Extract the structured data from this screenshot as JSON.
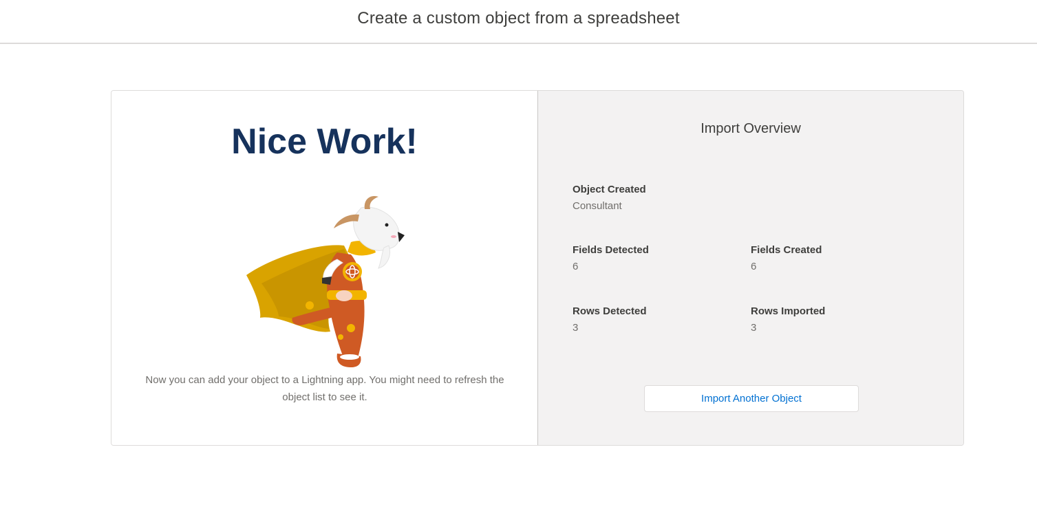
{
  "header": {
    "title": "Create a custom object from a spreadsheet"
  },
  "success": {
    "headline": "Nice Work!",
    "mascot_icon": "goat-superhero-mascot-icon",
    "message": "Now you can add your object to a Lightning app. You might need to refresh the object list to see it."
  },
  "overview": {
    "title": "Import Overview",
    "object_created": {
      "label": "Object Created",
      "value": "Consultant"
    },
    "fields_detected": {
      "label": "Fields Detected",
      "value": "6"
    },
    "fields_created": {
      "label": "Fields Created",
      "value": "6"
    },
    "rows_detected": {
      "label": "Rows Detected",
      "value": "3"
    },
    "rows_imported": {
      "label": "Rows Imported",
      "value": "3"
    },
    "button_label": "Import Another Object"
  },
  "colors": {
    "headline": "#16325c",
    "link": "#0070d2",
    "panel_bg": "#f3f2f2"
  }
}
